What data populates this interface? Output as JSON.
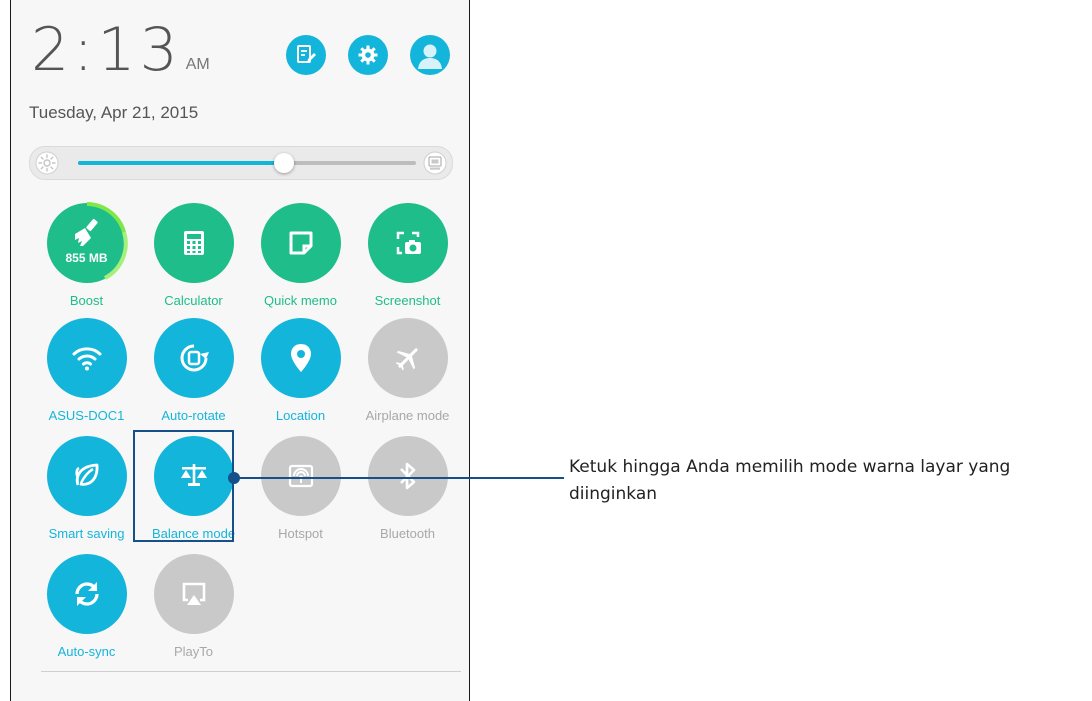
{
  "status": {
    "time": "2:13",
    "ampm": "AM",
    "date": "Tuesday, Apr 21, 2015"
  },
  "top_icons": [
    {
      "icon": "edit-note-icon"
    },
    {
      "icon": "gear-icon"
    },
    {
      "icon": "user-avatar-icon"
    }
  ],
  "brightness": {
    "level": 0.61,
    "auto_icon": "auto-brightness-icon",
    "low_icon": "brightness-low-icon"
  },
  "tiles": [
    {
      "label": "Boost",
      "value": "855 MB",
      "icon": "broom-icon",
      "state": "active"
    },
    {
      "label": "Calculator",
      "icon": "calculator-icon",
      "state": "active"
    },
    {
      "label": "Quick memo",
      "icon": "memo-icon",
      "state": "active"
    },
    {
      "label": "Screenshot",
      "icon": "screenshot-icon",
      "state": "active"
    },
    {
      "label": "ASUS-DOC1",
      "icon": "wifi-icon",
      "state": "active"
    },
    {
      "label": "Auto-rotate",
      "icon": "auto-rotate-icon",
      "state": "active"
    },
    {
      "label": "Location",
      "icon": "location-pin-icon",
      "state": "active"
    },
    {
      "label": "Airplane mode",
      "icon": "airplane-icon",
      "state": "inactive"
    },
    {
      "label": "Smart saving",
      "icon": "leaf-icon",
      "state": "active"
    },
    {
      "label": "Balance mode",
      "icon": "balance-scale-icon",
      "state": "active"
    },
    {
      "label": "Hotspot",
      "icon": "hotspot-icon",
      "state": "inactive"
    },
    {
      "label": "Bluetooth",
      "icon": "bluetooth-icon",
      "state": "inactive"
    },
    {
      "label": "Auto-sync",
      "icon": "sync-icon",
      "state": "active"
    },
    {
      "label": "PlayTo",
      "icon": "playto-icon",
      "state": "inactive"
    }
  ],
  "callout": {
    "text": "Ketuk hingga Anda memilih mode warna layar yang diinginkan"
  },
  "colors": {
    "green": "#1ebd8a",
    "blue": "#14b5da",
    "inactive": "#c9c9c9",
    "callout": "#15508a",
    "boost_ring": "#7ee84a"
  }
}
